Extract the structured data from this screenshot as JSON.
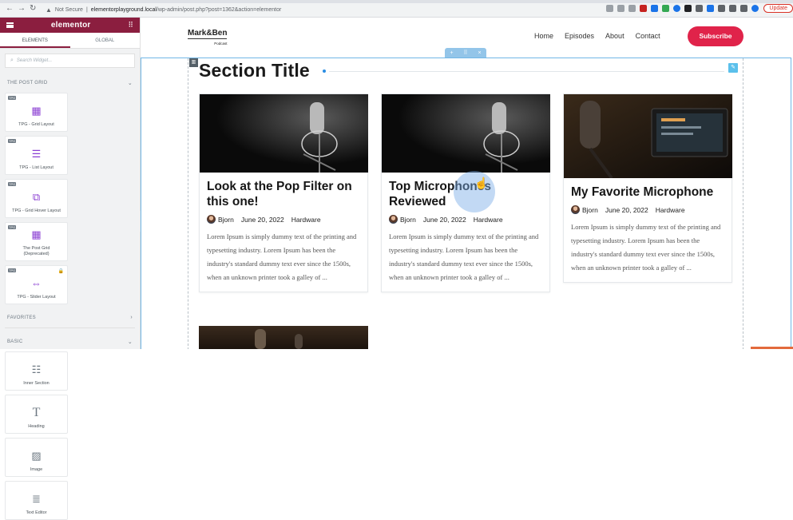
{
  "browser": {
    "not_secure": "Not Secure",
    "url_host": "elementorplayground.local",
    "url_path": "/wp-admin/post.php?post=1362&action=elementor",
    "update_label": "Update"
  },
  "panel": {
    "brand": "elementor",
    "tabs": [
      "ELEMENTS",
      "GLOBAL"
    ],
    "search_placeholder": "Search Widget...",
    "categories": {
      "post_grid": "THE POST GRID",
      "favorites": "FAVORITES",
      "basic": "BASIC"
    },
    "post_grid_widgets": [
      {
        "tag": "TPG",
        "label": "TPG - Grid Layout"
      },
      {
        "tag": "TPG",
        "label": "TPG - List Layout"
      },
      {
        "tag": "TPG",
        "label": "TPG - Grid Hover Layout"
      },
      {
        "tag": "TPG",
        "label": "The Post Grid (Deprecated)"
      },
      {
        "tag": "TPG",
        "label": "TPG - Slider Layout"
      }
    ],
    "basic_widgets": [
      {
        "label": "Inner Section"
      },
      {
        "label": "Heading"
      },
      {
        "label": "Image"
      },
      {
        "label": "Text Editor"
      }
    ]
  },
  "site": {
    "brand": "Mark&Ben",
    "brand_sub": "Podcast",
    "nav": [
      "Home",
      "Episodes",
      "About",
      "Contact"
    ],
    "subscribe": "Subscribe",
    "section_title": "Section Title"
  },
  "posts": [
    {
      "title": "Look at the Pop Filter on this one!",
      "author": "Bjorn",
      "date": "June 20, 2022",
      "category": "Hardware",
      "excerpt": "Lorem Ipsum is simply dummy text of the printing and typesetting industry. Lorem Ipsum has been the industry's standard dummy text ever since the 1500s, when an unknown printer took a galley of ..."
    },
    {
      "title": "Top Microphones Reviewed",
      "author": "Bjorn",
      "date": "June 20, 2022",
      "category": "Hardware",
      "excerpt": "Lorem Ipsum is simply dummy text of the printing and typesetting industry. Lorem Ipsum has been the industry's standard dummy text ever since the 1500s, when an unknown printer took a galley of ..."
    },
    {
      "title": "My Favorite Microphone",
      "author": "Bjorn",
      "date": "June 20, 2022",
      "category": "Hardware",
      "excerpt": "Lorem Ipsum is simply dummy text of the printing and typesetting industry. Lorem Ipsum has been the industry's standard dummy text ever since the 1500s, when an unknown printer took a galley of ..."
    }
  ],
  "colors": {
    "elementor": "#8b1e3f",
    "subscribe": "#e0234a",
    "section_outline": "#71b7e6"
  }
}
